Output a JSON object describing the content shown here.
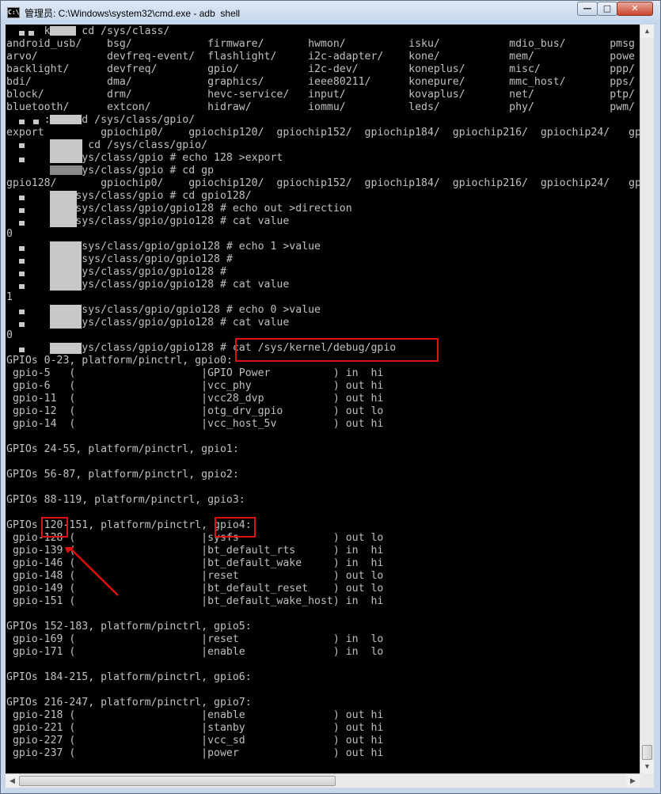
{
  "window": {
    "title": "管理员: C:\\Windows\\system32\\cmd.exe - adb  shell",
    "icon_label": "C:\\",
    "min_label": "—",
    "max_label": "□",
    "close_label": "✕"
  },
  "console": {
    "lines": [
      "      k:/ # cd /sys/class/",
      "android_usb/    bsg/            firmware/       hwmon/          isku/           mdio_bus/       pmsg",
      "arvo/           devfreq-event/  flashlight/     i2c-adapter/    kone/           mem/            powe",
      "backlight/      devfreq/        gpio/           i2c-dev/        koneplus/       misc/           ppp/",
      "bdi/            dma/            graphics/       ieee80211/      konepure/       mmc_host/       pps/",
      "block/          drm/            hevc-service/   input/          kovaplus/       net/            ptp/",
      "bluetooth/      extcon/         hidraw/         iommu/          leds/           phy/            pwm/",
      "      :/ # cd /sys/class/gpio/",
      "export         gpiochip0/    gpiochip120/  gpiochip152/  gpiochip184/  gpiochip216/  gpiochip24/   gp",
      "        :/ # cd /sys/class/gpio/",
      "         :/sys/class/gpio # echo 128 >export",
      "         :/sys/class/gpio # cd gp",
      "gpio128/       gpiochip0/    gpiochip120/  gpiochip152/  gpiochip184/  gpiochip216/  gpiochip24/   gp",
      "        k:/sys/class/gpio # cd gpio128/",
      "        k:/sys/class/gpio/gpio128 # echo out >direction",
      "        k:/sys/class/gpio/gpio128 # cat value",
      "0",
      "           /sys/class/gpio/gpio128 # echo 1 >value",
      "           /sys/class/gpio/gpio128 #",
      "        k:/sys/class/gpio/gpio128 #",
      "         :/sys/class/gpio/gpio128 # cat value",
      "1",
      "           /sys/class/gpio/gpio128 # echo 0 >value",
      "        k:/sys/class/gpio/gpio128 # cat value",
      "0",
      "         :/sys/class/gpio/gpio128 # cat /sys/kernel/debug/gpio",
      "GPIOs 0-23, platform/pinctrl, gpio0:",
      " gpio-5   (                    |GPIO Power          ) in  hi",
      " gpio-6   (                    |vcc_phy             ) out hi",
      " gpio-11  (                    |vcc28_dvp           ) out hi",
      " gpio-12  (                    |otg_drv_gpio        ) out lo",
      " gpio-14  (                    |vcc_host_5v         ) out hi",
      "",
      "GPIOs 24-55, platform/pinctrl, gpio1:",
      "",
      "GPIOs 56-87, platform/pinctrl, gpio2:",
      "",
      "GPIOs 88-119, platform/pinctrl, gpio3:",
      "",
      "GPIOs 120-151, platform/pinctrl, gpio4:",
      " gpio-128 (                    |sysfs               ) out lo",
      " gpio-139 (                    |bt_default_rts      ) in  hi",
      " gpio-146 (                    |bt_default_wake     ) in  hi",
      " gpio-148 (                    |reset               ) out lo",
      " gpio-149 (                    |bt_default_reset    ) out lo",
      " gpio-151 (                    |bt_default_wake_host) in  hi",
      "",
      "GPIOs 152-183, platform/pinctrl, gpio5:",
      " gpio-169 (                    |reset               ) in  lo",
      " gpio-171 (                    |enable              ) in  lo",
      "",
      "GPIOs 184-215, platform/pinctrl, gpio6:",
      "",
      "GPIOs 216-247, platform/pinctrl, gpio7:",
      " gpio-218 (                    |enable              ) out hi",
      " gpio-221 (                    |stanby              ) out hi",
      " gpio-227 (                    |vcc_sd              ) out hi",
      " gpio-237 (                    |power               ) out hi"
    ]
  },
  "scrollbars": {
    "up_arrow": "▲",
    "down_arrow": "▼",
    "left_arrow": "◀",
    "right_arrow": "▶"
  },
  "colors": {
    "console_bg": "#000000",
    "console_fg": "#c0c0c0",
    "highlight": "#e01010"
  }
}
